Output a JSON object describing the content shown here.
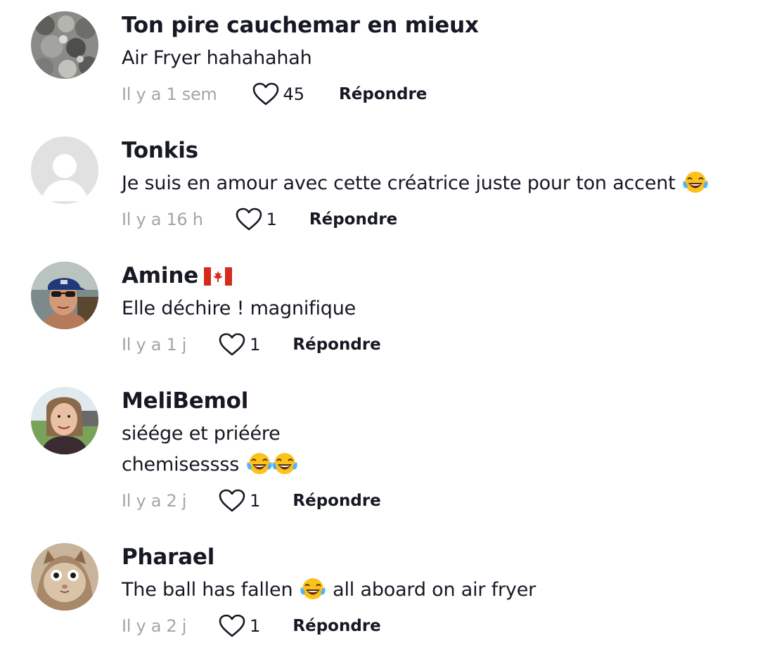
{
  "comments": [
    {
      "username": "Ton pire cauchemar en mieux",
      "lines": [
        "Air Fryer hahahahah"
      ],
      "time": "Il y a 1 sem",
      "likes": "45",
      "reply_label": "Répondre",
      "avatar": "collage-photo"
    },
    {
      "username": "Tonkis",
      "lines": [
        "Je suis en amour avec cette créatrice juste pour ton accent"
      ],
      "emoji_after": [
        "face-with-tears-of-joy"
      ],
      "time": "Il y a 16 h",
      "likes": "1",
      "reply_label": "Répondre",
      "avatar": "default-person"
    },
    {
      "username": "Amine",
      "flag": "canada-flag",
      "lines": [
        "Elle déchire ! magnifique"
      ],
      "time": "Il y a 1 j",
      "likes": "1",
      "reply_label": "Répondre",
      "avatar": "man-cap-sunglasses"
    },
    {
      "username": "MeliBemol",
      "lines": [
        "siéége et priéére",
        "chemisessss"
      ],
      "emoji_after": [
        "face-with-tears-of-joy",
        "face-with-tears-of-joy"
      ],
      "time": "Il y a 2 j",
      "likes": "1",
      "reply_label": "Répondre",
      "avatar": "woman-outdoors"
    },
    {
      "username": "Pharael",
      "lines": [
        "The ball has fallen",
        "all aboard on air fryer"
      ],
      "emoji_after": [
        "face-with-tears-of-joy"
      ],
      "time": "Il y a 2 j",
      "likes": "1",
      "reply_label": "Répondre",
      "avatar": "cat-photo"
    }
  ],
  "colors": {
    "text": "#161823",
    "muted": "#a5a5a9",
    "heart_outline": "#161823",
    "canada_red": "#d52b1e"
  }
}
